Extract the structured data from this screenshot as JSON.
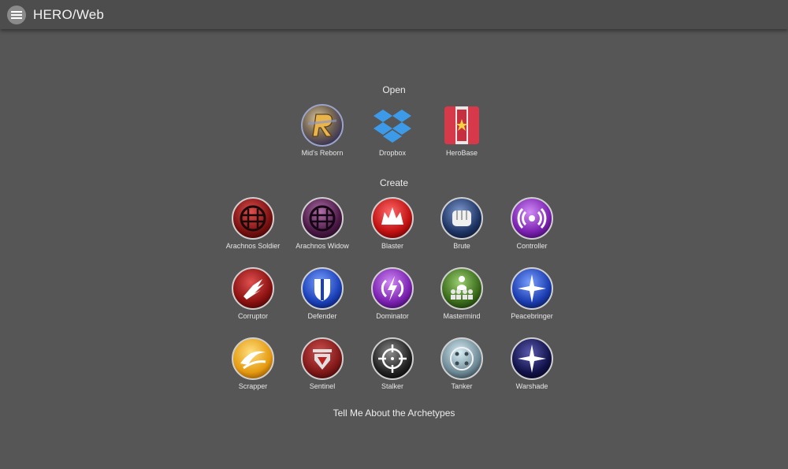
{
  "appbar": {
    "title": "HERO/Web",
    "menu_icon": "menu-icon"
  },
  "open_section": {
    "title": "Open",
    "items": [
      {
        "id": "mids-reborn",
        "label": "Mid's Reborn",
        "icon": "mids-reborn-logo"
      },
      {
        "id": "dropbox",
        "label": "Dropbox",
        "icon": "dropbox-logo"
      },
      {
        "id": "herobase",
        "label": "HeroBase",
        "icon": "herobase-logo"
      }
    ]
  },
  "create_section": {
    "title": "Create",
    "items": [
      {
        "id": "arachnos-soldier",
        "label": "Arachnos Soldier",
        "icon": "arachnos-soldier-icon",
        "color": "#8b1a1a"
      },
      {
        "id": "arachnos-widow",
        "label": "Arachnos Widow",
        "icon": "arachnos-widow-icon",
        "color": "#5a1f52"
      },
      {
        "id": "blaster",
        "label": "Blaster",
        "icon": "blaster-icon",
        "color": "#c81e1e"
      },
      {
        "id": "brute",
        "label": "Brute",
        "icon": "brute-icon",
        "color": "#223a6e"
      },
      {
        "id": "controller",
        "label": "Controller",
        "icon": "controller-icon",
        "color": "#8a2eb8"
      },
      {
        "id": "corruptor",
        "label": "Corruptor",
        "icon": "corruptor-icon",
        "color": "#a51515"
      },
      {
        "id": "defender",
        "label": "Defender",
        "icon": "defender-icon",
        "color": "#1f4fc8"
      },
      {
        "id": "dominator",
        "label": "Dominator",
        "icon": "dominator-icon",
        "color": "#8a2eb8"
      },
      {
        "id": "mastermind",
        "label": "Mastermind",
        "icon": "mastermind-icon",
        "color": "#3f6e22"
      },
      {
        "id": "peacebringer",
        "label": "Peacebringer",
        "icon": "peacebringer-icon",
        "color": "#2048c0"
      },
      {
        "id": "scrapper",
        "label": "Scrapper",
        "icon": "scrapper-icon",
        "color": "#e8a317"
      },
      {
        "id": "sentinel",
        "label": "Sentinel",
        "icon": "sentinel-icon",
        "color": "#8f1c1c"
      },
      {
        "id": "stalker",
        "label": "Stalker",
        "icon": "stalker-icon",
        "color": "#2a2a2a"
      },
      {
        "id": "tanker",
        "label": "Tanker",
        "icon": "tanker-icon",
        "color": "#7d9aa6"
      },
      {
        "id": "warshade",
        "label": "Warshade",
        "icon": "warshade-icon",
        "color": "#15154a"
      }
    ]
  },
  "footer_link": {
    "label": "Tell Me About the Archetypes"
  }
}
